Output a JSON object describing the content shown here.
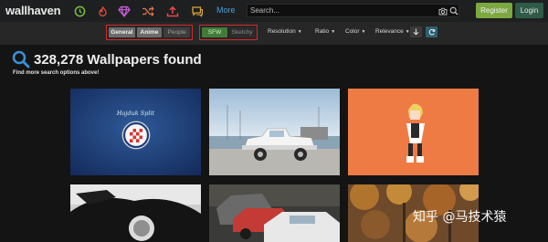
{
  "header": {
    "logo": "wallhaven",
    "more_label": "More",
    "nav_icons": [
      "clock-icon",
      "flame-icon",
      "gem-icon",
      "shuffle-icon",
      "upload-icon",
      "chat-icon"
    ],
    "search_placeholder": "Search...",
    "register_label": "Register",
    "login_label": "Login"
  },
  "filters": {
    "categories": [
      {
        "label": "General",
        "active": true
      },
      {
        "label": "Anime",
        "active": true
      },
      {
        "label": "People",
        "active": false
      }
    ],
    "purity": [
      {
        "label": "SFW",
        "active": true
      },
      {
        "label": "Sketchy",
        "active": false
      }
    ],
    "dropdowns": [
      "Resolution",
      "Ratio",
      "Color",
      "Relevance"
    ]
  },
  "results": {
    "count_text": "328,278 Wallpapers found",
    "subtitle": "Find more search options above!"
  },
  "thumbnails": {
    "t1_caption": "Hajduk Split"
  },
  "watermark": "知乎 @马技术猿",
  "colors": {
    "accent_blue": "#4f9fd6",
    "register_green": "#7ba83f",
    "login_green": "#2e5b47",
    "highlight_red": "#d12a2a"
  }
}
